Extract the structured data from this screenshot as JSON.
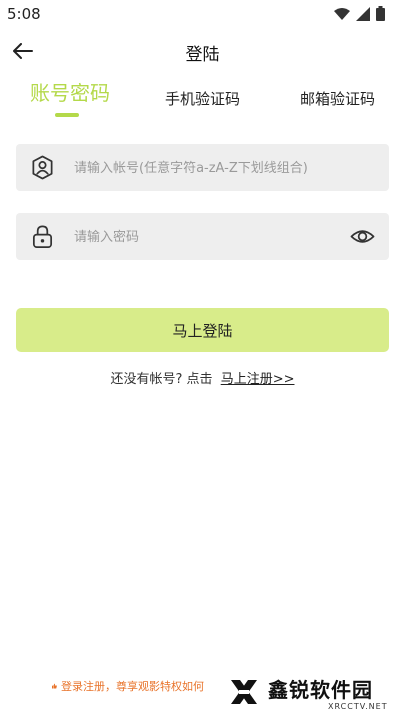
{
  "status_bar": {
    "time": "5:08"
  },
  "nav": {
    "title": "登陆"
  },
  "tabs": [
    {
      "label": "账号密码",
      "active": true
    },
    {
      "label": "手机验证码",
      "active": false
    },
    {
      "label": "邮箱验证码",
      "active": false
    }
  ],
  "form": {
    "account_placeholder": "请输入帐号(任意字符a-zA-Z下划线组合)",
    "password_placeholder": "请输入密码"
  },
  "login_button": "马上登陆",
  "register": {
    "prompt": "还没有帐号? 点击",
    "link": "马上注册>>"
  },
  "promo": {
    "text": "登录注册，尊享观影特权如何"
  },
  "watermark": {
    "name": "鑫锐软件园",
    "sub": "XRCCTV.NET"
  },
  "colors": {
    "accent": "#b4d94a",
    "button": "#d8ec8a",
    "promo": "#e8732a"
  }
}
